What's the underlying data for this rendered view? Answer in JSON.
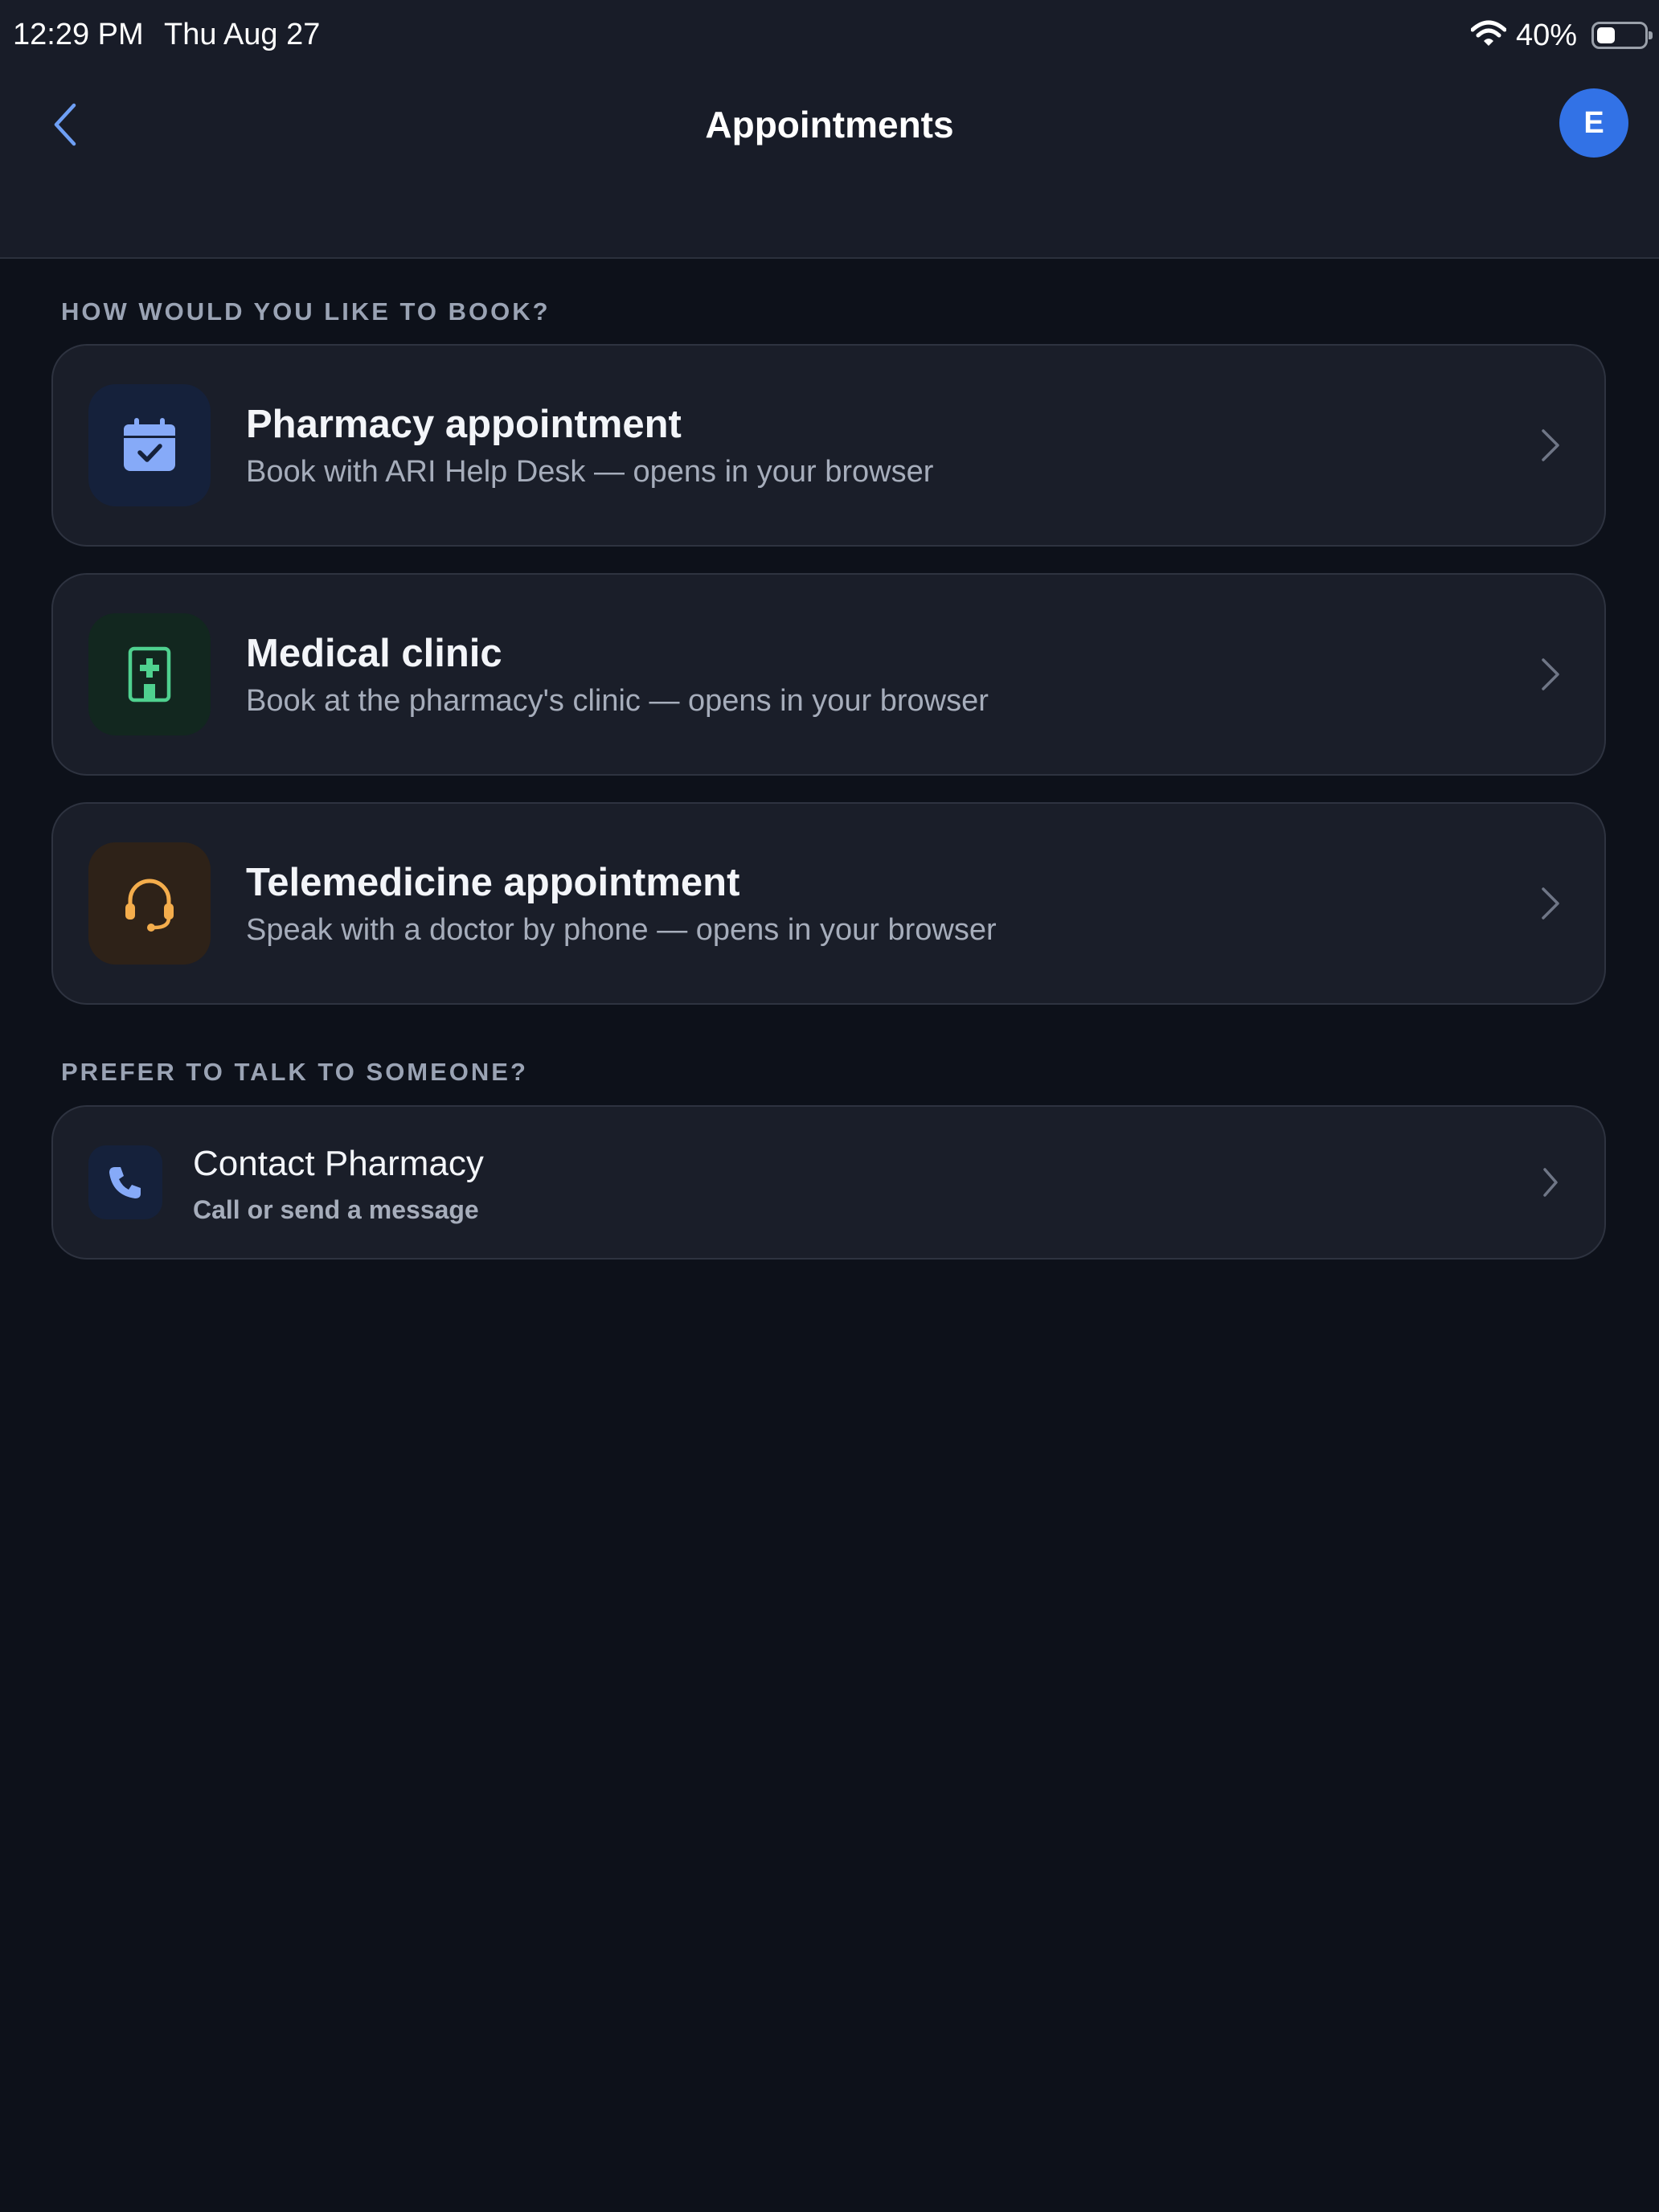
{
  "status_bar": {
    "time": "12:29 PM",
    "date": "Thu Aug 27",
    "battery": "40%"
  },
  "nav": {
    "title": "Appointments",
    "avatar_initial": "E"
  },
  "sections": {
    "book_header": "HOW WOULD YOU LIKE TO BOOK?",
    "talk_header": "PREFER TO TALK TO SOMEONE?"
  },
  "options": [
    {
      "title": "Pharmacy appointment",
      "subtitle": "Book with ARI Help Desk — opens in your browser",
      "icon": "calendar-check-icon",
      "tile_color": "#15213b",
      "icon_color": "#86aaf8"
    },
    {
      "title": "Medical clinic",
      "subtitle": "Book at the pharmacy's clinic — opens in your browser",
      "icon": "hospital-icon",
      "tile_color": "#12271f",
      "icon_color": "#4fd18f"
    },
    {
      "title": "Telemedicine appointment",
      "subtitle": "Speak with a doctor by phone — opens in your browser",
      "icon": "headset-icon",
      "tile_color": "#2e2218",
      "icon_color": "#f4ad4c"
    }
  ],
  "contact": {
    "title": "Contact Pharmacy",
    "subtitle": "Call or send a message",
    "icon": "phone-icon",
    "tile_color": "#15213b",
    "icon_color": "#86aaf8"
  }
}
